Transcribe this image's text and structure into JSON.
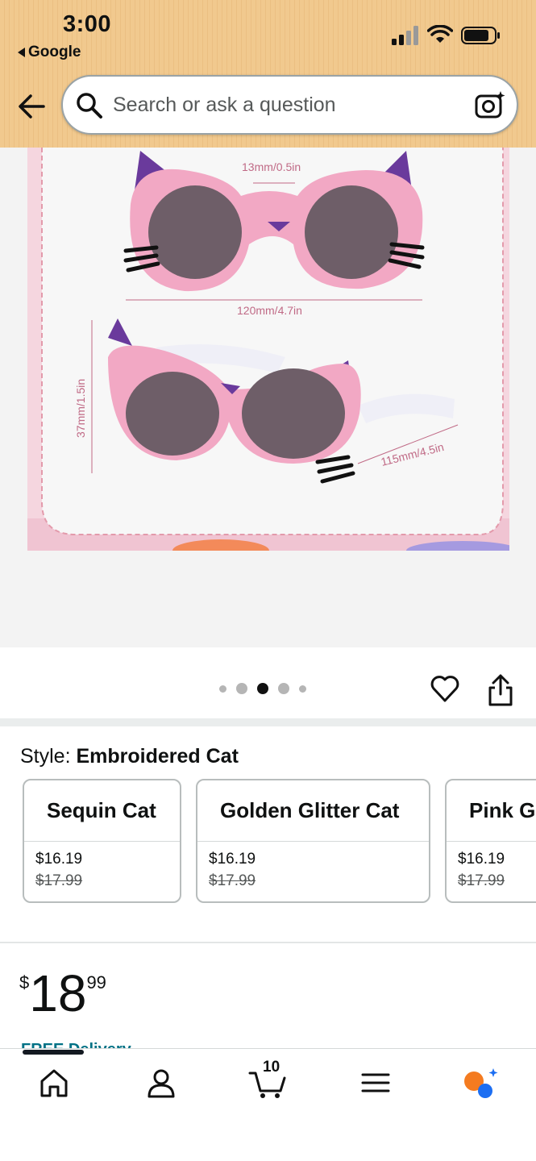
{
  "status_bar": {
    "time": "3:00",
    "back_app": "Google"
  },
  "search": {
    "placeholder": "Search or ask a question"
  },
  "product_image": {
    "dimension_labels": [
      "13mm/0.5in",
      "120mm/4.7in",
      "37mm/1.5in",
      "115mm/4.5in"
    ],
    "carousel": {
      "count": 5,
      "active_index": 2
    }
  },
  "style": {
    "label": "Style: ",
    "selected": "Embroidered Cat",
    "options": [
      {
        "name": "Sequin Cat",
        "price": "$16.19",
        "was": "$17.99"
      },
      {
        "name": "Golden Glitter Cat",
        "price": "$16.19",
        "was": "$17.99"
      },
      {
        "name": "Pink G",
        "price": "$16.19",
        "was": "$17.99"
      }
    ]
  },
  "price": {
    "currency": "$",
    "whole": "18",
    "fraction": "99"
  },
  "peek_text": "FREE Delivery",
  "bottom_nav": {
    "cart_count": "10",
    "items": [
      "home-icon",
      "account-icon",
      "cart-icon",
      "menu-icon",
      "rufus-ai-icon"
    ]
  },
  "colors": {
    "header": "#f1c98e",
    "link": "#007185",
    "frame_pink": "#f4cfd9",
    "glasses_pink": "#f2a8c4"
  }
}
